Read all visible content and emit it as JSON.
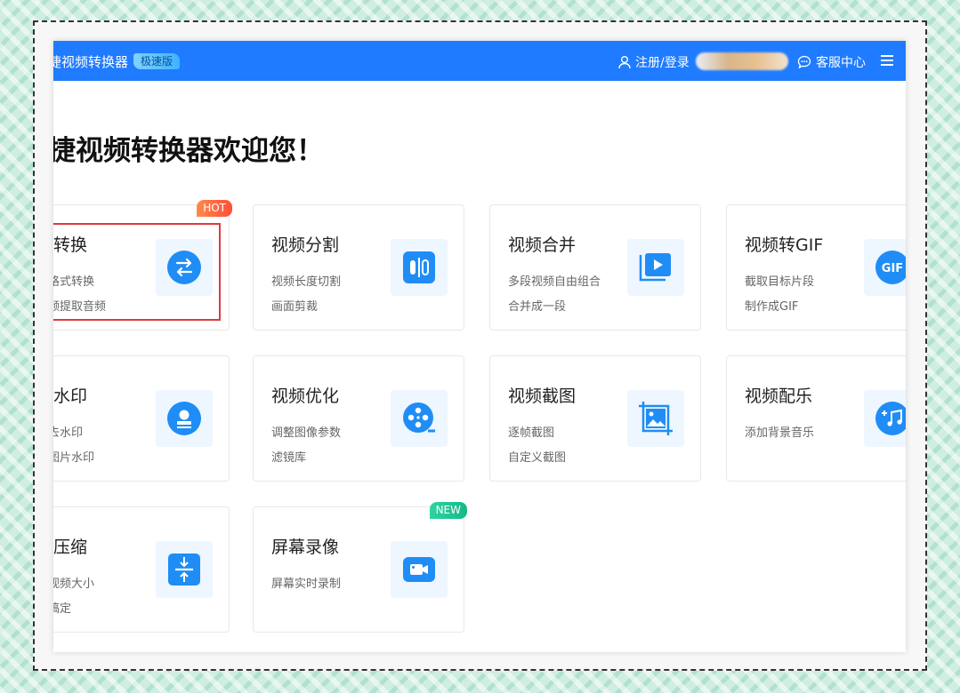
{
  "header": {
    "app_title": "捷视频转换器",
    "edition_badge": "极速版",
    "login_label": "注册/登录",
    "support_label": "客服中心"
  },
  "welcome": "捷视频转换器欢迎您！",
  "cards": [
    {
      "title": "频转换",
      "line1": "频格式转换",
      "line2": "视频提取音频",
      "badge": "HOT",
      "icon": "convert-icon"
    },
    {
      "title": "视频分割",
      "line1": "视频长度切割",
      "line2": "画面剪裁",
      "icon": "split-icon"
    },
    {
      "title": "视频合并",
      "line1": "多段视频自由组合",
      "line2": "合并成一段",
      "icon": "merge-icon"
    },
    {
      "title": "视频转GIF",
      "line1": "截取目标片段",
      "line2": "制作成GIF",
      "icon": "gif-icon"
    },
    {
      "title": "频水印",
      "line1": "频去水印",
      "line2": "加图片水印",
      "icon": "watermark-icon"
    },
    {
      "title": "视频优化",
      "line1": "调整图像参数",
      "line2": "滤镜库",
      "icon": "film-reel-icon"
    },
    {
      "title": "视频截图",
      "line1": "逐帧截图",
      "line2": "自定义截图",
      "icon": "screenshot-icon"
    },
    {
      "title": "视频配乐",
      "line1": "添加背景音乐",
      "icon": "music-icon"
    },
    {
      "title": "频压缩",
      "line1": "缩视频大小",
      "line2": "键搞定",
      "icon": "compress-icon"
    },
    {
      "title": "屏幕录像",
      "line1": "屏幕实时录制",
      "badge": "NEW",
      "icon": "screen-record-icon"
    }
  ],
  "icon_labels": {
    "gif": "GIF"
  },
  "colors": {
    "primary": "#1f7bff",
    "highlight": "#e0393e",
    "hot": "#ff5a3c",
    "new": "#1fc495"
  }
}
